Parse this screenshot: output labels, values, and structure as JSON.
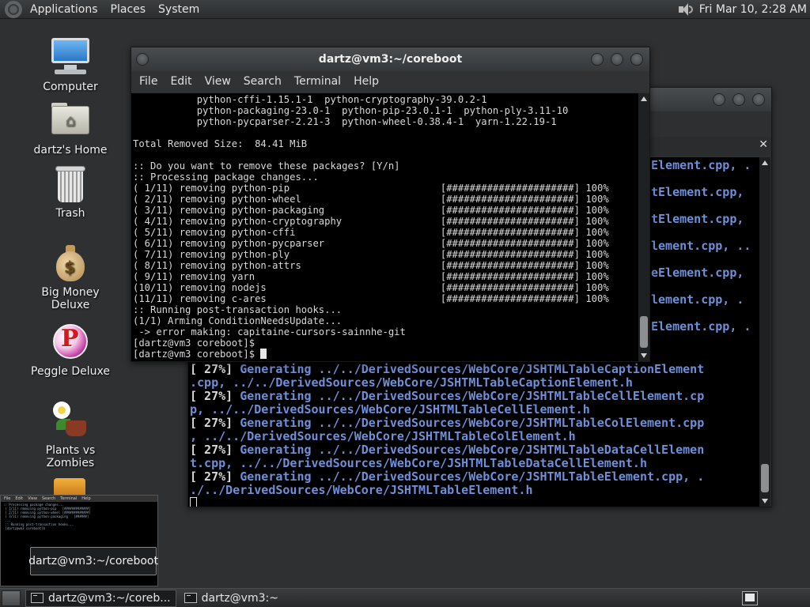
{
  "top_panel": {
    "menus": [
      "Applications",
      "Places",
      "System"
    ],
    "clock": "Fri Mar 10,  2:28 AM"
  },
  "desktop_icons": [
    {
      "label": "Computer",
      "icon": "computer-icon"
    },
    {
      "label": "dartz's Home",
      "icon": "home-folder-icon"
    },
    {
      "label": "Trash",
      "icon": "trash-icon"
    },
    {
      "label": "Big Money Deluxe",
      "icon": "money-bag-icon"
    },
    {
      "label": "Peggle Deluxe",
      "icon": "peggle-icon"
    },
    {
      "label": "Plants vs Zombies",
      "icon": "plants-vs-zombies-icon"
    }
  ],
  "front_window": {
    "title": "dartz@vm3:~/coreboot",
    "menu": [
      "File",
      "Edit",
      "View",
      "Search",
      "Terminal",
      "Help"
    ],
    "lines": [
      "           python-cffi-1.15.1-1  python-cryptography-39.0.2-1",
      "           python-packaging-23.0-1  python-pip-23.0.1-1  python-ply-3.11-10",
      "           python-pycparser-2.21-3  python-wheel-0.38.4-1  yarn-1.22.19-1",
      "",
      "Total Removed Size:  84.41 MiB",
      "",
      ":: Do you want to remove these packages? [Y/n]",
      ":: Processing package changes...",
      "( 1/11) removing python-pip                          [######################] 100%",
      "( 2/11) removing python-wheel                        [######################] 100%",
      "( 3/11) removing python-packaging                    [######################] 100%",
      "( 4/11) removing python-cryptography                 [######################] 100%",
      "( 5/11) removing python-cffi                         [######################] 100%",
      "( 6/11) removing python-pycparser                    [######################] 100%",
      "( 7/11) removing python-ply                          [######################] 100%",
      "( 8/11) removing python-attrs                        [######################] 100%",
      "( 9/11) removing yarn                                [######################] 100%",
      "(10/11) removing nodejs                              [######################] 100%",
      "(11/11) removing c-ares                              [######################] 100%",
      ":: Running post-transaction hooks...",
      "(1/1) Arming ConditionNeedsUpdate...",
      " -> error making: capitaine-cursors-sainnhe-git",
      "[dartz@vm3 coreboot]$",
      "[dartz@vm3 coreboot]$ "
    ]
  },
  "back_window": {
    "right_fragments": [
      "Element.cpp, .",
      "",
      "tElement.cpp,",
      "",
      "tElement.cpp,",
      "",
      "lement.cpp, ..",
      "",
      "eElement.cpp,",
      "",
      "lement.cpp, .",
      "",
      "Element.cpp, ."
    ],
    "lines": [
      {
        "pre": "[ 27%] ",
        "gen": "Generating ../../DerivedSources/WebCore/JSHTMLTableCaptionElement",
        "post": ""
      },
      {
        "pre": "",
        "gen": ".cpp, ../../DerivedSources/WebCore/JSHTMLTableCaptionElement.h",
        "post": ""
      },
      {
        "pre": "[ 27%] ",
        "gen": "Generating ../../DerivedSources/WebCore/JSHTMLTableCellElement.cp",
        "post": ""
      },
      {
        "pre": "",
        "gen": "p, ../../DerivedSources/WebCore/JSHTMLTableCellElement.h",
        "post": ""
      },
      {
        "pre": "[ 27%] ",
        "gen": "Generating ../../DerivedSources/WebCore/JSHTMLTableColElement.cpp",
        "post": ""
      },
      {
        "pre": "",
        "gen": ", ../../DerivedSources/WebCore/JSHTMLTableColElement.h",
        "post": ""
      },
      {
        "pre": "[ 27%] ",
        "gen": "Generating ../../DerivedSources/WebCore/JSHTMLTableDataCellElemen",
        "post": ""
      },
      {
        "pre": "",
        "gen": "t.cpp, ../../DerivedSources/WebCore/JSHTMLTableDataCellElement.h",
        "post": ""
      },
      {
        "pre": "[ 27%] ",
        "gen": "Generating ../../DerivedSources/WebCore/JSHTMLTableElement.cpp, .",
        "post": ""
      },
      {
        "pre": "",
        "gen": "./../DerivedSources/WebCore/JSHTMLTableElement.h",
        "post": ""
      }
    ]
  },
  "tooltip": "dartz@vm3:~/coreboot",
  "taskbar": {
    "tasks": [
      "dartz@vm3:~/coreb...",
      "dartz@vm3:~"
    ]
  },
  "colors": {
    "generating": "#6f8fd8",
    "panel": "#2b2d2f"
  }
}
